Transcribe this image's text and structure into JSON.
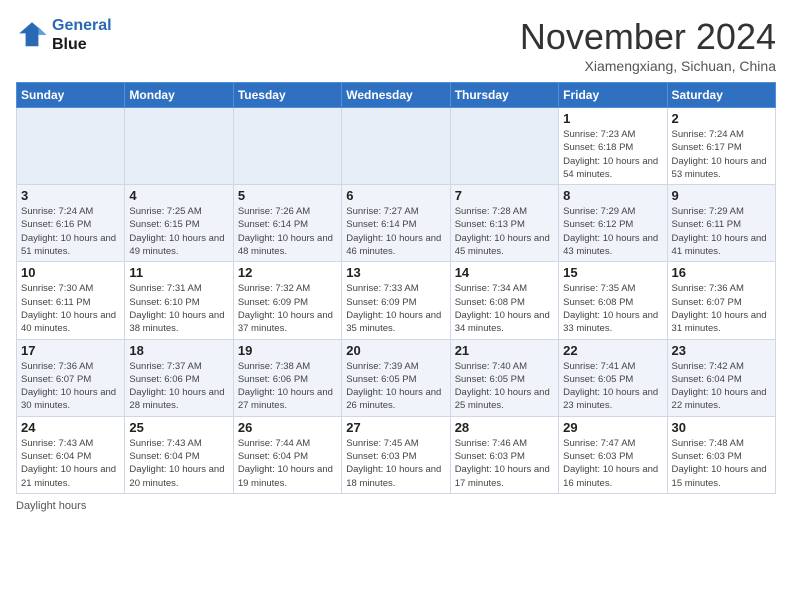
{
  "header": {
    "logo_line1": "General",
    "logo_line2": "Blue",
    "title": "November 2024",
    "location": "Xiamengxiang, Sichuan, China"
  },
  "days_of_week": [
    "Sunday",
    "Monday",
    "Tuesday",
    "Wednesday",
    "Thursday",
    "Friday",
    "Saturday"
  ],
  "footer": {
    "daylight_label": "Daylight hours"
  },
  "weeks": [
    [
      {
        "day": "",
        "info": ""
      },
      {
        "day": "",
        "info": ""
      },
      {
        "day": "",
        "info": ""
      },
      {
        "day": "",
        "info": ""
      },
      {
        "day": "",
        "info": ""
      },
      {
        "day": "1",
        "info": "Sunrise: 7:23 AM\nSunset: 6:18 PM\nDaylight: 10 hours and 54 minutes."
      },
      {
        "day": "2",
        "info": "Sunrise: 7:24 AM\nSunset: 6:17 PM\nDaylight: 10 hours and 53 minutes."
      }
    ],
    [
      {
        "day": "3",
        "info": "Sunrise: 7:24 AM\nSunset: 6:16 PM\nDaylight: 10 hours and 51 minutes."
      },
      {
        "day": "4",
        "info": "Sunrise: 7:25 AM\nSunset: 6:15 PM\nDaylight: 10 hours and 49 minutes."
      },
      {
        "day": "5",
        "info": "Sunrise: 7:26 AM\nSunset: 6:14 PM\nDaylight: 10 hours and 48 minutes."
      },
      {
        "day": "6",
        "info": "Sunrise: 7:27 AM\nSunset: 6:14 PM\nDaylight: 10 hours and 46 minutes."
      },
      {
        "day": "7",
        "info": "Sunrise: 7:28 AM\nSunset: 6:13 PM\nDaylight: 10 hours and 45 minutes."
      },
      {
        "day": "8",
        "info": "Sunrise: 7:29 AM\nSunset: 6:12 PM\nDaylight: 10 hours and 43 minutes."
      },
      {
        "day": "9",
        "info": "Sunrise: 7:29 AM\nSunset: 6:11 PM\nDaylight: 10 hours and 41 minutes."
      }
    ],
    [
      {
        "day": "10",
        "info": "Sunrise: 7:30 AM\nSunset: 6:11 PM\nDaylight: 10 hours and 40 minutes."
      },
      {
        "day": "11",
        "info": "Sunrise: 7:31 AM\nSunset: 6:10 PM\nDaylight: 10 hours and 38 minutes."
      },
      {
        "day": "12",
        "info": "Sunrise: 7:32 AM\nSunset: 6:09 PM\nDaylight: 10 hours and 37 minutes."
      },
      {
        "day": "13",
        "info": "Sunrise: 7:33 AM\nSunset: 6:09 PM\nDaylight: 10 hours and 35 minutes."
      },
      {
        "day": "14",
        "info": "Sunrise: 7:34 AM\nSunset: 6:08 PM\nDaylight: 10 hours and 34 minutes."
      },
      {
        "day": "15",
        "info": "Sunrise: 7:35 AM\nSunset: 6:08 PM\nDaylight: 10 hours and 33 minutes."
      },
      {
        "day": "16",
        "info": "Sunrise: 7:36 AM\nSunset: 6:07 PM\nDaylight: 10 hours and 31 minutes."
      }
    ],
    [
      {
        "day": "17",
        "info": "Sunrise: 7:36 AM\nSunset: 6:07 PM\nDaylight: 10 hours and 30 minutes."
      },
      {
        "day": "18",
        "info": "Sunrise: 7:37 AM\nSunset: 6:06 PM\nDaylight: 10 hours and 28 minutes."
      },
      {
        "day": "19",
        "info": "Sunrise: 7:38 AM\nSunset: 6:06 PM\nDaylight: 10 hours and 27 minutes."
      },
      {
        "day": "20",
        "info": "Sunrise: 7:39 AM\nSunset: 6:05 PM\nDaylight: 10 hours and 26 minutes."
      },
      {
        "day": "21",
        "info": "Sunrise: 7:40 AM\nSunset: 6:05 PM\nDaylight: 10 hours and 25 minutes."
      },
      {
        "day": "22",
        "info": "Sunrise: 7:41 AM\nSunset: 6:05 PM\nDaylight: 10 hours and 23 minutes."
      },
      {
        "day": "23",
        "info": "Sunrise: 7:42 AM\nSunset: 6:04 PM\nDaylight: 10 hours and 22 minutes."
      }
    ],
    [
      {
        "day": "24",
        "info": "Sunrise: 7:43 AM\nSunset: 6:04 PM\nDaylight: 10 hours and 21 minutes."
      },
      {
        "day": "25",
        "info": "Sunrise: 7:43 AM\nSunset: 6:04 PM\nDaylight: 10 hours and 20 minutes."
      },
      {
        "day": "26",
        "info": "Sunrise: 7:44 AM\nSunset: 6:04 PM\nDaylight: 10 hours and 19 minutes."
      },
      {
        "day": "27",
        "info": "Sunrise: 7:45 AM\nSunset: 6:03 PM\nDaylight: 10 hours and 18 minutes."
      },
      {
        "day": "28",
        "info": "Sunrise: 7:46 AM\nSunset: 6:03 PM\nDaylight: 10 hours and 17 minutes."
      },
      {
        "day": "29",
        "info": "Sunrise: 7:47 AM\nSunset: 6:03 PM\nDaylight: 10 hours and 16 minutes."
      },
      {
        "day": "30",
        "info": "Sunrise: 7:48 AM\nSunset: 6:03 PM\nDaylight: 10 hours and 15 minutes."
      }
    ]
  ]
}
